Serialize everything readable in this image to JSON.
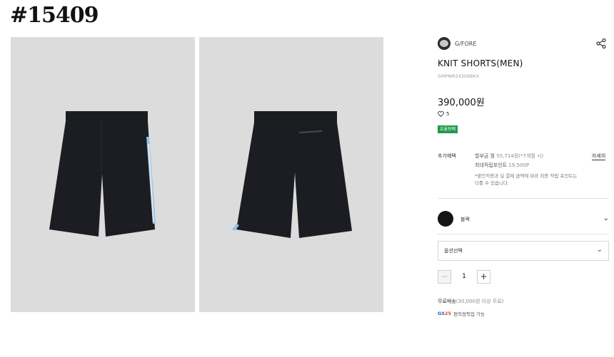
{
  "page_tag": "#15409",
  "brand": {
    "name": "G/FORE",
    "logo_icon": "brand-logo-icon"
  },
  "share_icon": "share-icon",
  "product": {
    "title": "KNIT SHORTS(MEN)",
    "code": "GMPNM24306BKX",
    "price": "390,000원",
    "likes": "5",
    "badge": "효율왕배"
  },
  "benefits": {
    "label": "추가혜택",
    "installment_prefix": "할부금 월",
    "installment_amount": "55,714원",
    "installment_suffix": "(*7개월 시)",
    "points_prefix": "최대적립포인트",
    "points_amount": "19,500P",
    "detail_link": "자세히",
    "note": "*할인적용과 실 결제 금액에 따라 최종 적립 포인트는 다를 수 있습니다."
  },
  "color": {
    "name": "블랙",
    "swatch": "#151515"
  },
  "option": {
    "label": "옵션선택"
  },
  "quantity": {
    "minus": "−",
    "value": "1",
    "plus": "+"
  },
  "shipping": {
    "label": "무료배송",
    "condition": "(30,000원 이상 무료)"
  },
  "gs": {
    "logo_gs": "GS",
    "logo_25": "25",
    "text": "편의점픽업 가능"
  },
  "images": [
    {
      "view": "front",
      "waistband": "elastic",
      "accent": "#7fb8e0"
    },
    {
      "view": "back",
      "waistband": "elastic",
      "accent": "#7fb8e0"
    }
  ]
}
